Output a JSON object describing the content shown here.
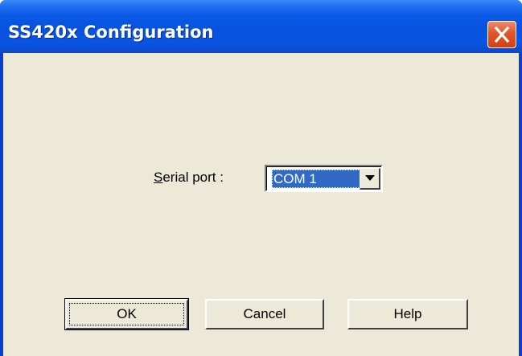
{
  "window": {
    "title": "SS420x Configuration"
  },
  "form": {
    "serial_port_label": "Serial port :",
    "serial_port_mnemonic": "S",
    "serial_port_label_rest": "erial port :",
    "serial_port_value": "COM 1"
  },
  "buttons": {
    "ok": "OK",
    "cancel": "Cancel",
    "help": "Help"
  },
  "icons": {
    "close": "close-icon",
    "dropdown": "chevron-down-icon"
  },
  "colors": {
    "titlebar": "#0a58e6",
    "close_button": "#e2552b",
    "client_background": "#ece9d8",
    "selection": "#316ac5"
  }
}
